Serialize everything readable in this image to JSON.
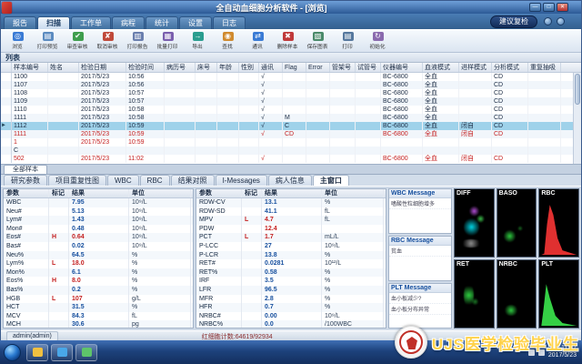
{
  "window": {
    "title": "全自动血细胞分析软件 - [浏览]",
    "controls": {
      "minimize": "—",
      "maximize": "□",
      "close": "✕"
    }
  },
  "menu": {
    "tabs": [
      "报告",
      "扫描",
      "工作单",
      "病程",
      "统计",
      "设置",
      "日志"
    ],
    "active_index": 1,
    "advise_button": "建议复检"
  },
  "toolbar": {
    "buttons": [
      {
        "label": "浏览",
        "icon": "browse-icon"
      },
      {
        "label": "打印预览",
        "icon": "print-preview-icon"
      },
      {
        "label": "审查审核",
        "icon": "review-approve-icon"
      },
      {
        "label": "取消审核",
        "icon": "cancel-approve-icon"
      },
      {
        "label": "打印报告",
        "icon": "print-report-icon"
      },
      {
        "label": "批量打印",
        "icon": "batch-print-icon"
      },
      {
        "label": "导出",
        "icon": "export-icon"
      },
      {
        "label": "查找",
        "icon": "search-icon"
      },
      {
        "label": "通讯",
        "icon": "comm-icon"
      },
      {
        "label": "删除样本",
        "icon": "delete-sample-icon"
      },
      {
        "label": "保存图表",
        "icon": "save-chart-icon"
      },
      {
        "label": "打印",
        "icon": "print-icon"
      },
      {
        "label": "初始化",
        "icon": "init-icon"
      }
    ]
  },
  "list_label": "列表",
  "sample_table": {
    "columns": [
      "样本编号",
      "姓名",
      "检验日期",
      "检验时间",
      "病历号",
      "床号",
      "年龄",
      "性别",
      "通讯",
      "Flag",
      "Error",
      "管架号",
      "试管号",
      "仪器编号",
      "血液模式",
      "进样模式",
      "分析模式",
      "重复抽吸"
    ],
    "rows": [
      {
        "cells": [
          "1100",
          "",
          "2017/5/23",
          "10:56",
          "",
          "",
          "",
          "",
          "√",
          "",
          "",
          "",
          "",
          "BC-6800",
          "全血",
          "",
          "CD",
          ""
        ],
        "red": false,
        "selected": false
      },
      {
        "cells": [
          "1107",
          "",
          "2017/5/23",
          "10:56",
          "",
          "",
          "",
          "",
          "√",
          "",
          "",
          "",
          "",
          "BC-6800",
          "全血",
          "",
          "CD",
          ""
        ],
        "red": false,
        "selected": false
      },
      {
        "cells": [
          "1108",
          "",
          "2017/5/23",
          "10:57",
          "",
          "",
          "",
          "",
          "√",
          "",
          "",
          "",
          "",
          "BC-6800",
          "全血",
          "",
          "CD",
          ""
        ],
        "red": false,
        "selected": false
      },
      {
        "cells": [
          "1109",
          "",
          "2017/5/23",
          "10:57",
          "",
          "",
          "",
          "",
          "√",
          "",
          "",
          "",
          "",
          "BC-6800",
          "全血",
          "",
          "CD",
          ""
        ],
        "red": false,
        "selected": false
      },
      {
        "cells": [
          "1110",
          "",
          "2017/5/23",
          "10:58",
          "",
          "",
          "",
          "",
          "√",
          "",
          "",
          "",
          "",
          "BC-6800",
          "全血",
          "",
          "CD",
          ""
        ],
        "red": false,
        "selected": false
      },
      {
        "cells": [
          "1111",
          "",
          "2017/5/23",
          "10:58",
          "",
          "",
          "",
          "",
          "√",
          "M",
          "",
          "",
          "",
          "BC-6800",
          "全血",
          "",
          "CD",
          ""
        ],
        "red": false,
        "selected": false
      },
      {
        "cells": [
          "1112",
          "",
          "2017/5/23",
          "10:59",
          "",
          "",
          "",
          "",
          "√",
          "C",
          "",
          "",
          "",
          "BC-6800",
          "全血",
          "闭自",
          "CD",
          ""
        ],
        "red": false,
        "selected": true
      },
      {
        "cells": [
          "1111",
          "",
          "2017/5/23",
          "10:59",
          "",
          "",
          "",
          "",
          "√",
          "CD",
          "",
          "",
          "",
          "BC-6800",
          "全血",
          "闭自",
          "CD",
          ""
        ],
        "red": true,
        "selected": false
      },
      {
        "cells": [
          "1",
          "",
          "2017/5/23",
          "10:59",
          "",
          "",
          "",
          "",
          "",
          "",
          "",
          "",
          "",
          "",
          "",
          "",
          "",
          ""
        ],
        "red": true,
        "selected": false
      },
      {
        "cells": [
          "C",
          "",
          "",
          "",
          "",
          "",
          "",
          "",
          "",
          "",
          "",
          "",
          "",
          "",
          "",
          "",
          "",
          ""
        ],
        "red": false,
        "selected": false
      },
      {
        "cells": [
          "502",
          "",
          "2017/5/23",
          "11:02",
          "",
          "",
          "",
          "",
          "√",
          "",
          "",
          "",
          "",
          "BC-6800",
          "全血",
          "闭自",
          "CD",
          ""
        ],
        "red": true,
        "selected": false
      }
    ]
  },
  "all_samples_tab": "全部样本",
  "section_tabs": [
    "研究参数",
    "项目重复性图",
    "WBC",
    "RBC",
    "结果对照",
    "I-Messages",
    "病人信息",
    "主窗口"
  ],
  "section_active_index": 7,
  "params_header": [
    "参数",
    "标记",
    "结果",
    "单位"
  ],
  "left_params": [
    {
      "p": "WBC",
      "f": "",
      "r": "7.95",
      "u": "10⁹/L",
      "red": false
    },
    {
      "p": "Neu#",
      "f": "",
      "r": "5.13",
      "u": "10⁹/L",
      "red": false
    },
    {
      "p": "Lym#",
      "f": "",
      "r": "1.43",
      "u": "10⁹/L",
      "red": false
    },
    {
      "p": "Mon#",
      "f": "",
      "r": "0.48",
      "u": "10⁹/L",
      "red": false
    },
    {
      "p": "Eos#",
      "f": "H",
      "r": "0.64",
      "u": "10⁹/L",
      "red": true
    },
    {
      "p": "Bas#",
      "f": "",
      "r": "0.02",
      "u": "10⁹/L",
      "red": false
    },
    {
      "p": "Neu%",
      "f": "",
      "r": "64.5",
      "u": "%",
      "red": false
    },
    {
      "p": "Lym%",
      "f": "L",
      "r": "18.0",
      "u": "%",
      "red": true
    },
    {
      "p": "Mon%",
      "f": "",
      "r": "6.1",
      "u": "%",
      "red": false
    },
    {
      "p": "Eos%",
      "f": "H",
      "r": "8.0",
      "u": "%",
      "red": true
    },
    {
      "p": "Bas%",
      "f": "",
      "r": "0.2",
      "u": "%",
      "red": false
    },
    {
      "p": "HGB",
      "f": "L",
      "r": "107",
      "u": "g/L",
      "red": true
    },
    {
      "p": "HCT",
      "f": "",
      "r": "31.5",
      "u": "%",
      "red": false
    },
    {
      "p": "MCV",
      "f": "",
      "r": "84.3",
      "u": "fL",
      "red": false
    },
    {
      "p": "MCH",
      "f": "",
      "r": "30.6",
      "u": "pg",
      "red": false
    }
  ],
  "mid_params": [
    {
      "p": "RDW-CV",
      "f": "",
      "r": "13.1",
      "u": "%",
      "red": false
    },
    {
      "p": "RDW-SD",
      "f": "",
      "r": "41.1",
      "u": "fL",
      "red": false
    },
    {
      "p": "MPV",
      "f": "L",
      "r": "4.7",
      "u": "fL",
      "red": true
    },
    {
      "p": "PDW",
      "f": "",
      "r": "12.4",
      "u": "",
      "red": true
    },
    {
      "p": "PCT",
      "f": "L",
      "r": "1.7",
      "u": "mL/L",
      "red": true
    },
    {
      "p": "P-LCC",
      "f": "",
      "r": "27",
      "u": "10⁹/L",
      "red": false
    },
    {
      "p": "P-LCR",
      "f": "",
      "r": "13.8",
      "u": "%",
      "red": false
    },
    {
      "p": "RET#",
      "f": "",
      "r": "0.0281",
      "u": "10¹²/L",
      "red": false
    },
    {
      "p": "RET%",
      "f": "",
      "r": "0.58",
      "u": "%",
      "red": false
    },
    {
      "p": "IRF",
      "f": "",
      "r": "3.5",
      "u": "%",
      "red": false
    },
    {
      "p": "LFR",
      "f": "",
      "r": "96.5",
      "u": "%",
      "red": false
    },
    {
      "p": "MFR",
      "f": "",
      "r": "2.8",
      "u": "%",
      "red": false
    },
    {
      "p": "HFR",
      "f": "",
      "r": "0.7",
      "u": "%",
      "red": false
    },
    {
      "p": "NRBC#",
      "f": "",
      "r": "0.00",
      "u": "10⁹/L",
      "red": false
    },
    {
      "p": "NRBC%",
      "f": "",
      "r": "0.0",
      "u": "/100WBC",
      "red": false
    }
  ],
  "messages": [
    {
      "title": "WBC Message",
      "items": [
        "嗜酸性粒细胞增多"
      ]
    },
    {
      "title": "RBC Message",
      "items": [
        "贫血"
      ]
    },
    {
      "title": "PLT Message",
      "items": [
        "血小板减少?",
        "血小板分布异常"
      ]
    }
  ],
  "scattergrams": [
    {
      "label": "DIFF"
    },
    {
      "label": "BASO"
    },
    {
      "label": "RBC"
    },
    {
      "label": "RET"
    },
    {
      "label": "NRBC"
    },
    {
      "label": "PLT"
    }
  ],
  "status": {
    "user": "admin(admin)",
    "counter": "红细胞计数:64619/92934"
  },
  "taskbar": {
    "time": "11:47",
    "date": "2017/5/23"
  },
  "watermark": {
    "text": "UJS医学检验毕业生"
  }
}
